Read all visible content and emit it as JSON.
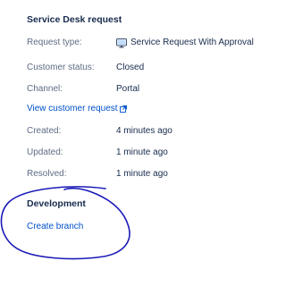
{
  "service_desk": {
    "title": "Service Desk request",
    "request_type": {
      "label": "Request type:",
      "value": "Service Request With Approval",
      "icon": "monitor-icon"
    },
    "customer_status": {
      "label": "Customer status:",
      "value": "Closed"
    },
    "channel": {
      "label": "Channel:",
      "value": "Portal"
    },
    "view_link": {
      "text": "View customer request",
      "icon": "external-link-icon"
    },
    "created": {
      "label": "Created:",
      "value": "4 minutes ago"
    },
    "updated": {
      "label": "Updated:",
      "value": "1 minute ago"
    },
    "resolved": {
      "label": "Resolved:",
      "value": "1 minute ago"
    }
  },
  "development": {
    "title": "Development",
    "create_branch": "Create branch"
  },
  "colors": {
    "heading": "#172b4d",
    "label": "#5e6c84",
    "link": "#0052cc",
    "annotation": "#1a1ab8"
  }
}
